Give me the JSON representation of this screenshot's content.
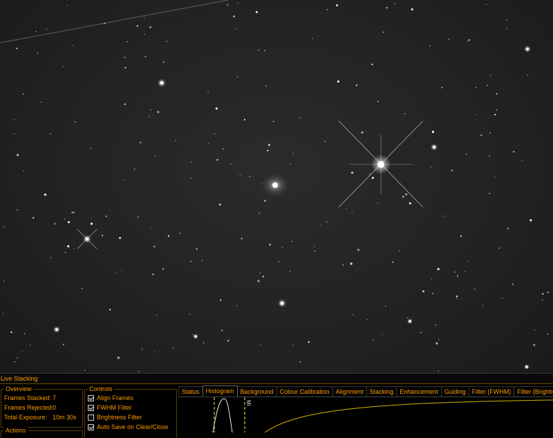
{
  "panel": {
    "title": "Live Stacking"
  },
  "overview": {
    "title": "Overview",
    "rows": [
      {
        "label": "Frames Stacked:",
        "value": "7"
      },
      {
        "label": "Frames Rejected:",
        "value": "0"
      },
      {
        "label": "Total Exposure:",
        "value": "10m 30s"
      }
    ]
  },
  "actions": {
    "title": "Actions"
  },
  "controls": {
    "title": "Controls",
    "items": [
      {
        "label": "Align Frames",
        "checked": true
      },
      {
        "label": "FWHM Filter",
        "checked": true
      },
      {
        "label": "Brightness Filter",
        "checked": false
      },
      {
        "label": "Auto Save on Clear/Close",
        "checked": true
      }
    ]
  },
  "tabs": [
    {
      "label": "Status",
      "active": false
    },
    {
      "label": "Histogram",
      "active": true
    },
    {
      "label": "Background",
      "active": false
    },
    {
      "label": "Colour Calibration",
      "active": false
    },
    {
      "label": "Alignment",
      "active": false
    },
    {
      "label": "Stacking",
      "active": false
    },
    {
      "label": "Enhancement",
      "active": false
    },
    {
      "label": "Guiding",
      "active": false
    },
    {
      "label": "Filter (FWHM)",
      "active": false
    },
    {
      "label": "Filter (Brightness)",
      "active": false
    }
  ],
  "histogram": {
    "marker_label": "Mi"
  },
  "colors": {
    "accent": "#ff9a00",
    "background": "#000000",
    "marker": "#ffff33"
  }
}
